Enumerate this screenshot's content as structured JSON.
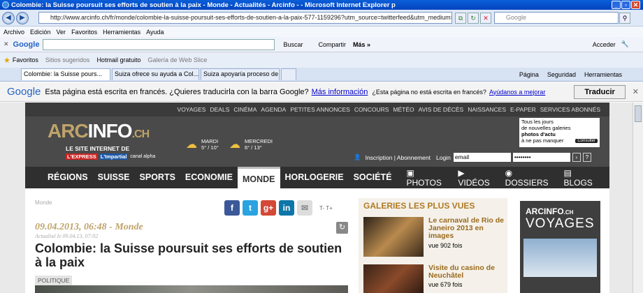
{
  "window": {
    "title": "Colombie: la Suisse poursuit ses efforts de soutien à la paix - Monde - Actualités - Arcinfo - - Microsoft Internet Explorer p"
  },
  "address": {
    "url": "http://www.arcinfo.ch/fr/monde/colombie-la-suisse-poursuit-ses-efforts-de-soutien-a-la-paix-577-1159296?utm_source=twitterfeed&utm_medium=twitter",
    "search_placeholder": "Google"
  },
  "menu": [
    "Archivo",
    "Edición",
    "Ver",
    "Favoritos",
    "Herramientas",
    "Ayuda"
  ],
  "gtoolbar": {
    "brand": "Google",
    "search_btn": "Buscar",
    "share": "Compartir",
    "more": "Más »",
    "signin": "Acceder"
  },
  "favbar": {
    "favorites": "Favoritos",
    "items": [
      "Sitios sugeridos",
      "Hotmail gratuito",
      "Galería de Web Slice"
    ]
  },
  "tabs": [
    "Colombie: la Suisse pours...",
    "Suiza ofrece su ayuda a Col...",
    "Suiza apoyaría proceso de p..."
  ],
  "cmdbar": [
    "Página",
    "Seguridad",
    "Herramientas"
  ],
  "translate": {
    "brand": "Google",
    "message": "Esta página está escrita en francés. ¿Quieres traducirla con la barra Google?",
    "more": "Más información",
    "question": "¿Esta página no está escrita en francés?",
    "help": "Ayúdanos a mejorar",
    "button": "Traducir"
  },
  "site": {
    "topnav": [
      "VOYAGES",
      "DEALS",
      "CINÉMA",
      "AGENDA",
      "PETITES ANNONCES",
      "CONCOURS",
      "MÉTÉO",
      "AVIS DE DÉCÈS",
      "NAISSANCES",
      "E-PAPER",
      "SERVICES ABONNÉS"
    ],
    "logo": {
      "arc": "ARC",
      "info": "INFO",
      "ch": ".CH",
      "tagline": "LE SITE INTERNET DE",
      "p1": "L'EXPRESS",
      "p2": "L'Impartial",
      "p3": "canal alpha"
    },
    "weather": [
      {
        "day": "MARDI",
        "temp": "5° / 10°"
      },
      {
        "day": "MERCREDI",
        "temp": "6° / 13°"
      }
    ],
    "promo": {
      "l1": "Tous les jours",
      "l2": "de nouvelles galeries",
      "l3": "photos d'actu",
      "l4": "à ne pas manquer",
      "btn": "Consulter"
    },
    "account": {
      "links": "Inscription | Abonnement",
      "login": "Login",
      "email": "email",
      "password": "••••••••",
      "help": "?"
    },
    "mainnav": [
      "RÉGIONS",
      "SUISSE",
      "SPORTS",
      "ECONOMIE",
      "MONDE",
      "HORLOGERIE",
      "SOCIÉTÉ"
    ],
    "sections": [
      "PHOTOS",
      "VIDÉOS",
      "DOSSIERS",
      "BLOGS"
    ],
    "article": {
      "breadcrumb": "Monde",
      "dateline": "09.04.2013, 06:48 - Monde",
      "updated": "Actualisé le 09.04.13, 07:02",
      "title": "Colombie: la Suisse poursuit ses efforts de soutien à la paix",
      "tag": "POLITIQUE",
      "textsize": "T- T+"
    },
    "gallery": {
      "heading": "GALERIES LES PLUS VUES",
      "items": [
        {
          "title": "Le carnaval de Rio de Janeiro 2013 en images",
          "views": "vue 902 fois"
        },
        {
          "title": "Visite du casino de Neuchâtel",
          "views": "vue 679 fois"
        }
      ]
    },
    "ad": {
      "arc": "ARCINFO",
      "ch": ".CH",
      "voyages": "VOYAGES"
    }
  }
}
